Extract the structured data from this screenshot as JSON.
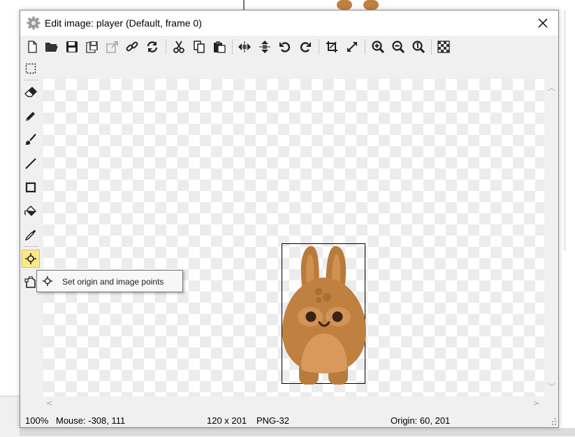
{
  "window": {
    "title": "Edit image: player (Default, frame 0)"
  },
  "toolbar": {
    "groups": [
      [
        "new-icon",
        "open-icon",
        "save-icon",
        "save-as-icon",
        "export-icon",
        "link-icon",
        "reload-icon"
      ],
      [
        "cut-icon",
        "copy-icon",
        "paste-icon"
      ],
      [
        "move-horizontal-icon",
        "move-vertical-icon",
        "undo-icon",
        "redo-icon"
      ],
      [
        "crop-icon",
        "resize-icon"
      ],
      [
        "zoom-in-icon",
        "zoom-out-icon",
        "zoom-reset-icon"
      ],
      [
        "transparency-icon"
      ]
    ]
  },
  "tools": [
    "select-tool-icon",
    "eraser-icon",
    "pencil-icon",
    "brush-icon",
    "line-icon",
    "rectangle-icon",
    "fill-bucket-icon",
    "eyedropper-icon",
    "origin-point-icon",
    "polygon-icon"
  ],
  "active_tool": "origin-point-icon",
  "tooltip": {
    "text": "Set origin and image points"
  },
  "status": {
    "zoom": "100%",
    "mouse": "Mouse: -308, 111",
    "size": "120 x 201",
    "format": "PNG-32",
    "origin": "Origin: 60, 201"
  },
  "colors": {
    "active_tool_bg": "#fde98a",
    "bunny_body": "#c0803f",
    "bunny_belly": "#d9995a",
    "bunny_eye": "#3a2214",
    "checker": "#ececec"
  }
}
